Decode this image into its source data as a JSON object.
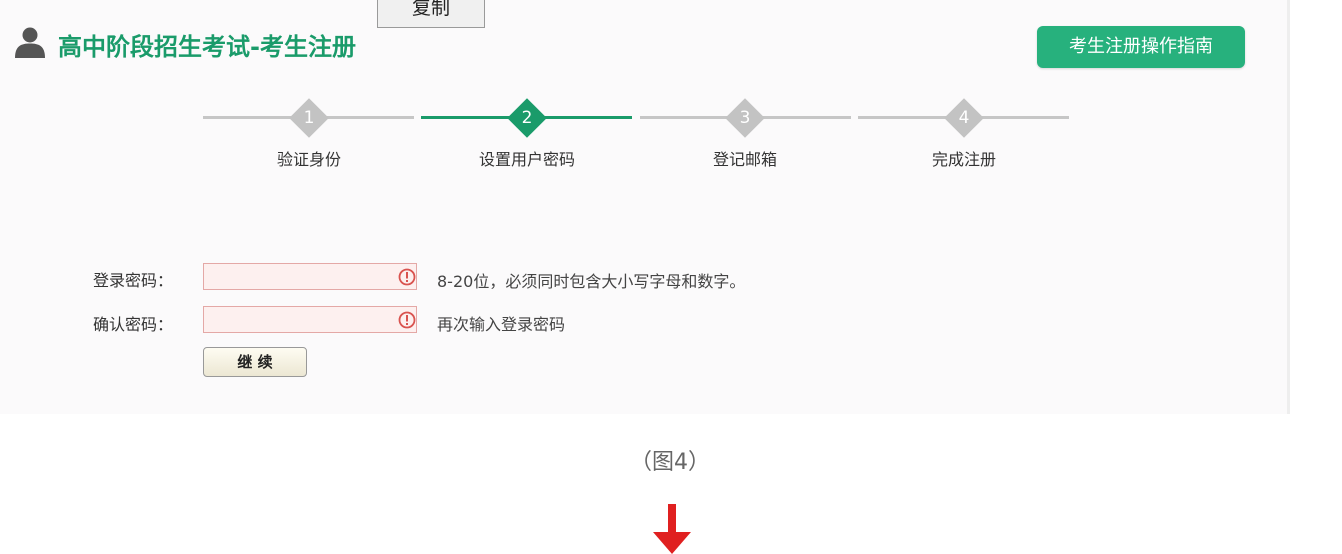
{
  "copy_button": {
    "label": "复制"
  },
  "header": {
    "title": "高中阶段招生考试-考生注册",
    "guide_button": "考生注册操作指南"
  },
  "steps": [
    {
      "number": "1",
      "label": "验证身份",
      "active": false
    },
    {
      "number": "2",
      "label": "设置用户密码",
      "active": true
    },
    {
      "number": "3",
      "label": "登记邮箱",
      "active": false
    },
    {
      "number": "4",
      "label": "完成注册",
      "active": false
    }
  ],
  "form": {
    "password": {
      "label": "登录密码：",
      "value": "",
      "hint": "8-20位，必须同时包含大小写字母和数字。"
    },
    "confirm": {
      "label": "确认密码：",
      "value": "",
      "hint": "再次输入登录密码"
    },
    "continue_button": "继 续"
  },
  "caption": "（图4）",
  "colors": {
    "accent_green": "#1a9b6a",
    "button_green": "#27b17d",
    "error_red": "#d9534f",
    "arrow_red": "#e02020"
  }
}
